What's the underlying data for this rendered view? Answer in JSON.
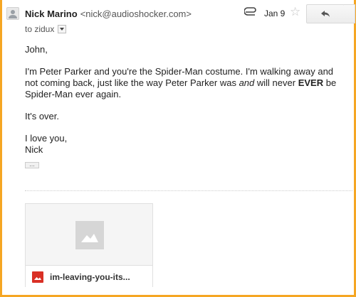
{
  "message": {
    "sender_name": "Nick Marino",
    "sender_email": "<nick@audioshocker.com>",
    "to_line": "to zidux",
    "date": "Jan 9",
    "greeting": "John,",
    "paragraph1_a": "I'm Peter Parker and you're the Spider-Man costume. I'm walking away and not coming back, just like the way Peter Parker was ",
    "paragraph1_and": "and",
    "paragraph1_b": " will never ",
    "paragraph1_ever": "EVER",
    "paragraph1_c": " be Spider-Man ever again.",
    "paragraph2": "It's over.",
    "closing": "I love you,",
    "signature": "Nick",
    "ellipsis": "..."
  },
  "attachment": {
    "file_name": "im-leaving-you-its..."
  },
  "colors": {
    "frame_border": "#f5a623",
    "file_icon": "#d93025"
  },
  "icons": {
    "avatar": "person-icon",
    "attachment": "paperclip-icon",
    "star": "star-icon",
    "reply": "reply-arrow-icon",
    "more": "chevron-down-icon",
    "image_placeholder": "image-icon",
    "file_type": "image-file-icon"
  }
}
